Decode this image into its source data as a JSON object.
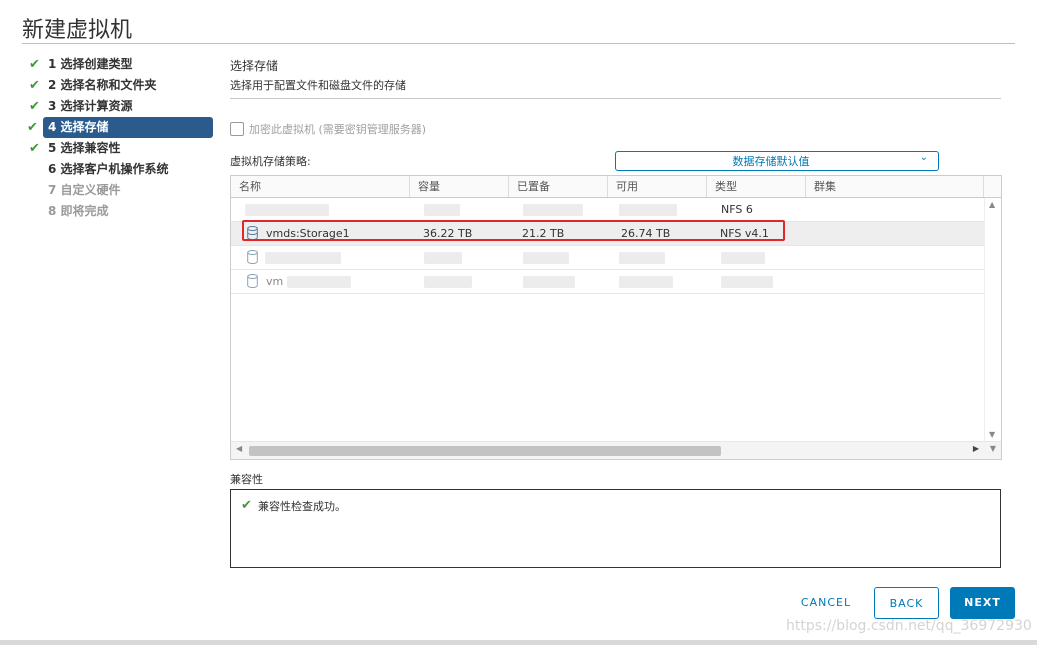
{
  "dialog": {
    "title": "新建虚拟机"
  },
  "steps": [
    {
      "label": "1 选择创建类型",
      "done": true
    },
    {
      "label": "2 选择名称和文件夹",
      "done": true
    },
    {
      "label": "3 选择计算资源",
      "done": true
    },
    {
      "label": "4 选择存储",
      "done": true,
      "active": true
    },
    {
      "label": "5 选择兼容性",
      "done": true
    },
    {
      "label": "6 选择客户机操作系统",
      "done": false
    },
    {
      "label": "7 自定义硬件",
      "done": false,
      "disabled": true
    },
    {
      "label": "8 即将完成",
      "done": false,
      "disabled": true
    }
  ],
  "section": {
    "title": "选择存储",
    "description": "选择用于配置文件和磁盘文件的存储"
  },
  "encrypt": {
    "label": "加密此虚拟机 (需要密钥管理服务器)",
    "checked": false
  },
  "policy": {
    "label": "虚拟机存储策略:",
    "value": "数据存储默认值"
  },
  "grid": {
    "columns": [
      "名称",
      "容量",
      "已置备",
      "可用",
      "类型",
      "群集"
    ],
    "rows": [
      {
        "name": "",
        "capacity": "",
        "provisioned": "",
        "free": "",
        "type": "NFS 6",
        "cluster": ""
      },
      {
        "name": "vmds:Storage1",
        "capacity": "36.22 TB",
        "provisioned": "21.2 TB",
        "free": "26.74 TB",
        "type": "NFS v4.1",
        "cluster": "",
        "selected": true
      },
      {
        "name": "",
        "capacity": "",
        "provisioned": "",
        "free": "",
        "type": "",
        "cluster": ""
      },
      {
        "name": "vm",
        "capacity": "",
        "provisioned": "",
        "free": "",
        "type": "",
        "cluster": ""
      }
    ]
  },
  "compatibility": {
    "label": "兼容性",
    "message": "兼容性检查成功。"
  },
  "buttons": {
    "cancel": "CANCEL",
    "back": "BACK",
    "next": "NEXT"
  },
  "watermark": "https://blog.csdn.net/qq_36972930",
  "colors": {
    "accent": "#0079b8",
    "active_step": "#2a5b8c",
    "success": "#3d9a36",
    "highlight": "#e0282b"
  }
}
